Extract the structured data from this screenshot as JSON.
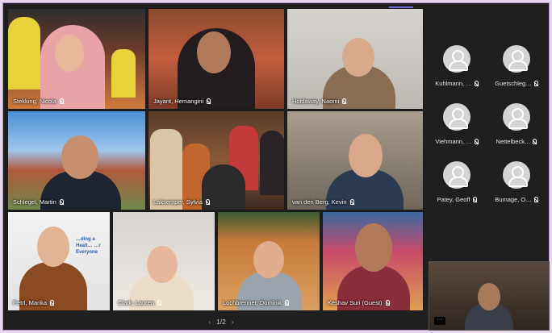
{
  "tiles": [
    {
      "name": "Stekking, Nicola"
    },
    {
      "name": "Jayant, Hemangini"
    },
    {
      "name": "Holdaway, Naomi"
    },
    {
      "name": "Schlegel, Martin"
    },
    {
      "name": "Laksemper, Sylvia"
    },
    {
      "name": "van den Berg, Kevin"
    },
    {
      "name": "Petrl, Marika",
      "background_text": "…ding a Healt… …r Everyone"
    },
    {
      "name": "Clark, Lauren"
    },
    {
      "name": "Lochbrenner, Dominik"
    },
    {
      "name": "Keshav Suri (Guest)"
    }
  ],
  "roster": [
    {
      "name": "Kuhlmann, …"
    },
    {
      "name": "Guetschleg…"
    },
    {
      "name": "Viehmann, …"
    },
    {
      "name": "Nettelbeck…"
    },
    {
      "name": "Patey, Geoff"
    },
    {
      "name": "Bumage, O…"
    }
  ],
  "pager": {
    "prev": "‹",
    "label": "1/2",
    "next": "›"
  },
  "self_view": {
    "more_label": "···"
  },
  "icons": {
    "mic": "mic-icon",
    "avatar": "person-avatar-icon"
  }
}
